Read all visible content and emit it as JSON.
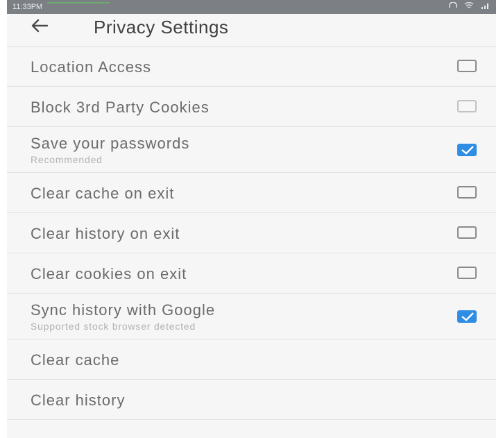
{
  "status_bar": {
    "time": "11:33PM",
    "icons": [
      "headset-icon",
      "wifi-icon",
      "signal-icon"
    ]
  },
  "header": {
    "back_icon": "arrow-left-icon",
    "title": "Privacy Settings"
  },
  "settings": [
    {
      "label": "Location Access",
      "checked": false
    },
    {
      "label": "Block 3rd Party Cookies",
      "checked": false
    },
    {
      "label": "Save your passwords",
      "sublabel": "Recommended",
      "checked": true
    },
    {
      "label": "Clear cache on exit",
      "checked": false
    },
    {
      "label": "Clear history on exit",
      "checked": false
    },
    {
      "label": "Clear cookies on exit",
      "checked": false
    },
    {
      "label": "Sync history with Google",
      "sublabel": "Supported stock browser detected",
      "checked": true
    },
    {
      "label": "Clear cache"
    },
    {
      "label": "Clear history"
    }
  ],
  "colors": {
    "accent": "#2f8de4",
    "background": "#f6f6f6",
    "status_bar": "#7c7f83"
  }
}
